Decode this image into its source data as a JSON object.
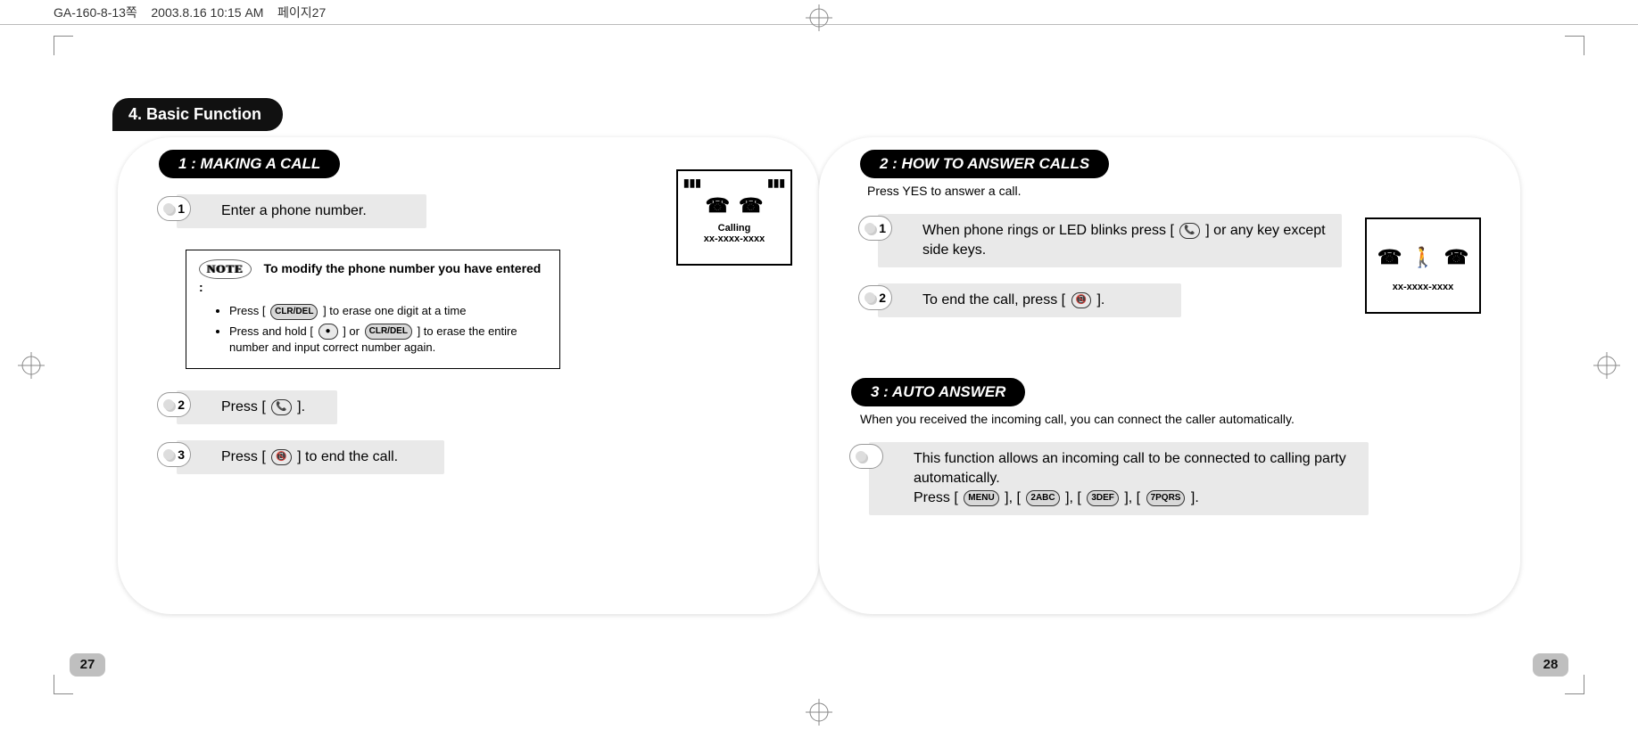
{
  "header": {
    "filename": "GA-160-8-13쪽",
    "timestamp": "2003.8.16 10:15 AM",
    "page_stub": "페이지27"
  },
  "chapter": {
    "title": "4. Basic Function"
  },
  "left_page": {
    "section_title": "1 : MAKING A CALL",
    "steps": {
      "s1": {
        "num": "1",
        "text": "Enter a phone number."
      },
      "s2": {
        "num": "2",
        "text_before": "Press [",
        "text_after": "]."
      },
      "s3": {
        "num": "3",
        "text_before": "Press [",
        "text_after": "] to end the call."
      }
    },
    "note": {
      "label": "NOTE",
      "title": "To modify the phone number you have entered :",
      "bullets": {
        "b1_before": "Press [",
        "b1_after": "] to erase one digit at a time",
        "b2_before": "Press and hold [",
        "b2_mid": "] or  ",
        "b2_after": "] to erase the entire number and input correct number again."
      }
    },
    "screen": {
      "calling": "Calling",
      "number": "xx-xxxx-xxxx"
    },
    "page_num": "27"
  },
  "right_page": {
    "section2": {
      "title": "2 : HOW TO ANSWER CALLS",
      "subtitle": "Press YES to answer a call.",
      "steps": {
        "s1": {
          "num": "1",
          "text_before": "When phone rings or LED blinks press [",
          "text_after": "] or any key except side keys."
        },
        "s2": {
          "num": "2",
          "text_before": "To end the call, press [",
          "text_after": "]."
        }
      }
    },
    "section3": {
      "title": "3 : AUTO ANSWER",
      "subtitle": "When you received the incoming call, you can connect the caller automatically.",
      "body_line1": "This function allows an incoming call to be connected to calling party automatically.",
      "body_line2_before": "Press [",
      "body_line2_after": "]."
    },
    "screen": {
      "number": "xx-xxxx-xxxx"
    },
    "page_num": "28"
  },
  "icons": {
    "signal": "▮▮▮",
    "battery": "▮▮▮",
    "phone": "☎",
    "send": "📞",
    "end": "📵",
    "clr": "CLR/DEL",
    "ok": "●",
    "menu": "MENU",
    "k2": "2ABC",
    "k3": "3DEF",
    "k7": "7PQRS",
    "walk": "🚶"
  }
}
